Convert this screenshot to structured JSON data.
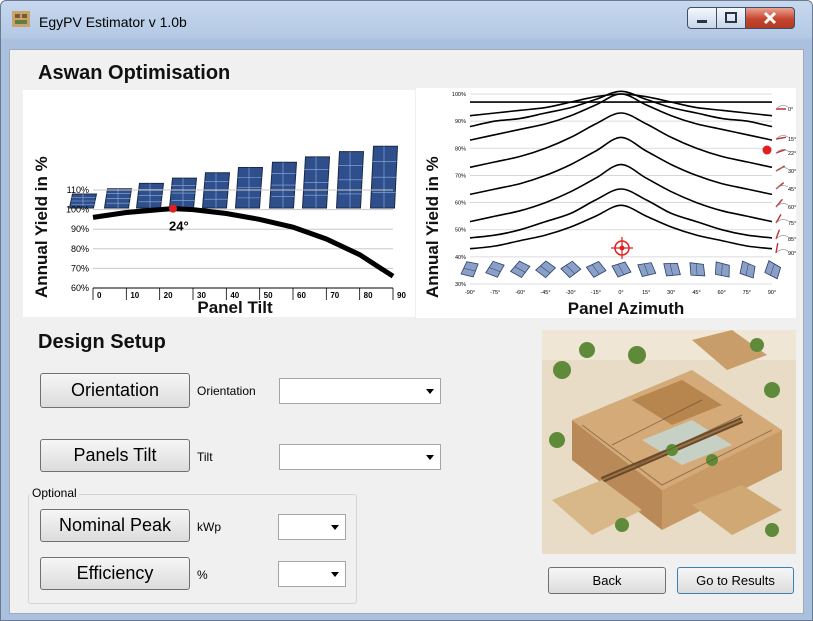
{
  "window": {
    "title": "EgyPV Estimator v 1.0b"
  },
  "optimisation": {
    "title": "Aswan Optimisation",
    "tilt_chart": {
      "ylabel": "Annual Yield in %",
      "xlabel": "Panel Tilt",
      "y_ticks": [
        "110%",
        "100%",
        "90%",
        "80%",
        "70%",
        "60%"
      ],
      "x_ticks": [
        "0",
        "10",
        "20",
        "30",
        "40",
        "50",
        "60",
        "70",
        "80",
        "90"
      ],
      "optimum_label": "24°"
    },
    "azimuth_chart": {
      "ylabel": "Annual Yield in %",
      "xlabel": "Panel Azimuth",
      "y_ticks": [
        "100%",
        "90%",
        "80%",
        "70%",
        "60%",
        "50%",
        "40%",
        "30%"
      ],
      "x_ticks": [
        "-90°",
        "-75°",
        "-60°",
        "-45°",
        "-30°",
        "-15°",
        "0°",
        "15°",
        "30°",
        "45°",
        "60°",
        "75°",
        "90°"
      ],
      "tilt_labels": [
        "0°",
        "15°",
        "22°",
        "30°",
        "45°",
        "60°",
        "75°",
        "85°",
        "90°"
      ]
    }
  },
  "design": {
    "title": "Design Setup",
    "orientation": {
      "button": "Orientation",
      "label": "Orientation",
      "value": ""
    },
    "tilt": {
      "button": "Panels Tilt",
      "label": "Tilt",
      "value": ""
    },
    "optional": {
      "title": "Optional",
      "peak": {
        "button": "Nominal Peak",
        "label": "kWp",
        "value": ""
      },
      "efficiency": {
        "button": "Efficiency",
        "label": "%",
        "value": ""
      }
    }
  },
  "nav": {
    "back": "Back",
    "results": "Go to Results"
  },
  "chart_data": [
    {
      "type": "line",
      "title": "",
      "xlabel": "Panel Tilt",
      "ylabel": "Annual Yield in %",
      "x": [
        0,
        10,
        20,
        24,
        30,
        40,
        50,
        60,
        70,
        80,
        90
      ],
      "series": [
        {
          "values": [
            96,
            98.5,
            100,
            100.5,
            100,
            98,
            95,
            91,
            85,
            77,
            66
          ]
        }
      ],
      "xlim": [
        0,
        90
      ],
      "ylim": [
        60,
        110
      ],
      "grid": true
    },
    {
      "type": "line",
      "title": "",
      "xlabel": "Panel Azimuth",
      "ylabel": "Annual Yield in %",
      "x": [
        -90,
        -75,
        -60,
        -45,
        -30,
        -15,
        0,
        15,
        30,
        45,
        60,
        75,
        90
      ],
      "series": [
        {
          "name": "0°",
          "values": [
            97,
            97,
            97,
            97,
            97,
            97,
            97,
            97,
            97,
            97,
            97,
            97,
            97
          ]
        },
        {
          "name": "15°",
          "values": [
            92,
            93,
            94,
            95,
            97,
            99,
            100,
            99,
            97,
            95,
            94,
            93,
            92
          ]
        },
        {
          "name": "22°",
          "values": [
            88,
            90,
            91,
            93,
            95,
            98,
            101,
            98,
            95,
            93,
            91,
            90,
            88
          ]
        },
        {
          "name": "30°",
          "values": [
            83,
            85,
            87,
            89,
            92,
            96,
            100,
            96,
            92,
            89,
            87,
            85,
            83
          ]
        },
        {
          "name": "45°",
          "values": [
            73,
            75,
            77,
            80,
            84,
            89,
            93,
            89,
            84,
            80,
            77,
            75,
            73
          ]
        },
        {
          "name": "60°",
          "values": [
            63,
            65,
            67,
            70,
            74,
            79,
            84,
            79,
            74,
            70,
            67,
            65,
            63
          ]
        },
        {
          "name": "75°",
          "values": [
            53,
            55,
            57,
            60,
            64,
            69,
            74,
            69,
            64,
            60,
            57,
            55,
            53
          ]
        },
        {
          "name": "85°",
          "values": [
            47,
            48,
            50,
            53,
            56,
            61,
            65,
            61,
            56,
            53,
            50,
            48,
            47
          ]
        },
        {
          "name": "90°",
          "values": [
            43,
            44,
            46,
            48,
            51,
            55,
            59,
            55,
            51,
            48,
            46,
            44,
            43
          ]
        }
      ],
      "xlim": [
        -90,
        90
      ],
      "ylim": [
        30,
        100
      ],
      "grid": true
    }
  ]
}
